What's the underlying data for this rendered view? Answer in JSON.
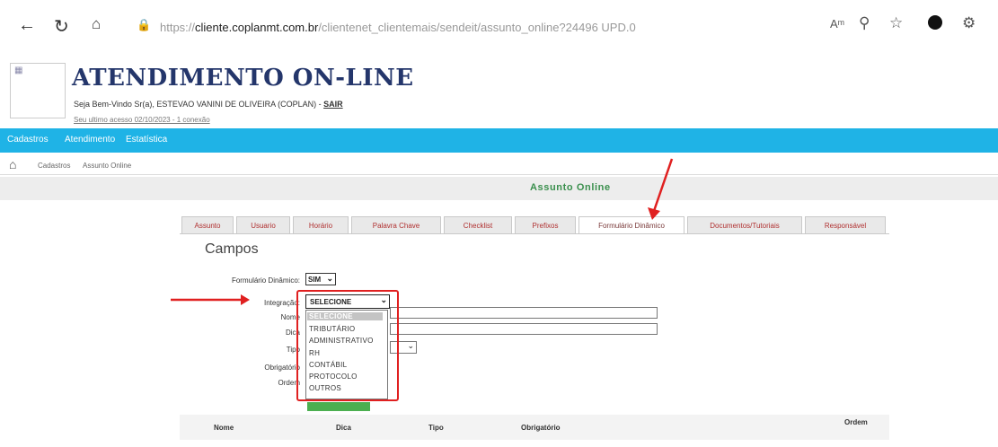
{
  "browser": {
    "url_prefix": "https://",
    "url_host": "cliente.coplanmt.com.br",
    "url_path": "/clientenet_clientemais/sendeit/assunto_online?24496 UPD.0"
  },
  "header": {
    "title": "ATENDIMENTO ON-LINE",
    "welcome": "Seja Bem-Vindo Sr(a), ESTEVAO VANINI DE OLIVEIRA (COPLAN) -",
    "logout": "SAIR",
    "last_access": "Seu ultimo acesso 02/10/2023 - 1 conexão"
  },
  "menu": [
    "Cadastros",
    "Atendimento",
    "Estatística"
  ],
  "breadcrumb": [
    "Cadastros",
    "Assunto Online"
  ],
  "section_title": "Assunto Online",
  "tabs": [
    "Assunto",
    "Usuario",
    "Horário",
    "Palavra Chave",
    "Checklist",
    "Prefixos",
    "Formulário Dinâmico",
    "Documentos/Tutoriais",
    "Responsável"
  ],
  "form": {
    "heading": "Campos",
    "formulario_dinamico_label": "Formulário Dinâmico:",
    "formulario_dinamico_value": "SIM",
    "integracao_label": "Integração:",
    "integracao_value": "SELECIONE",
    "nome_label": "Nome",
    "dica_label": "Dica",
    "tipo_label": "Tipo",
    "obrigatorio_label": "Obrigatório",
    "ordem_label": "Ordem"
  },
  "dropdown_options": [
    "SELECIONE",
    "TRIBUTÁRIO",
    "ADMINISTRATIVO",
    "RH",
    "CONTÁBIL",
    "PROTOCOLO",
    "OUTROS"
  ],
  "table_headers": [
    "Nome",
    "Dica",
    "Tipo",
    "Obrigatório",
    "Ordem"
  ],
  "colors": {
    "menu_bar": "#1fb3e6",
    "highlight": "#e02020",
    "section_title": "#3a8f4d"
  }
}
